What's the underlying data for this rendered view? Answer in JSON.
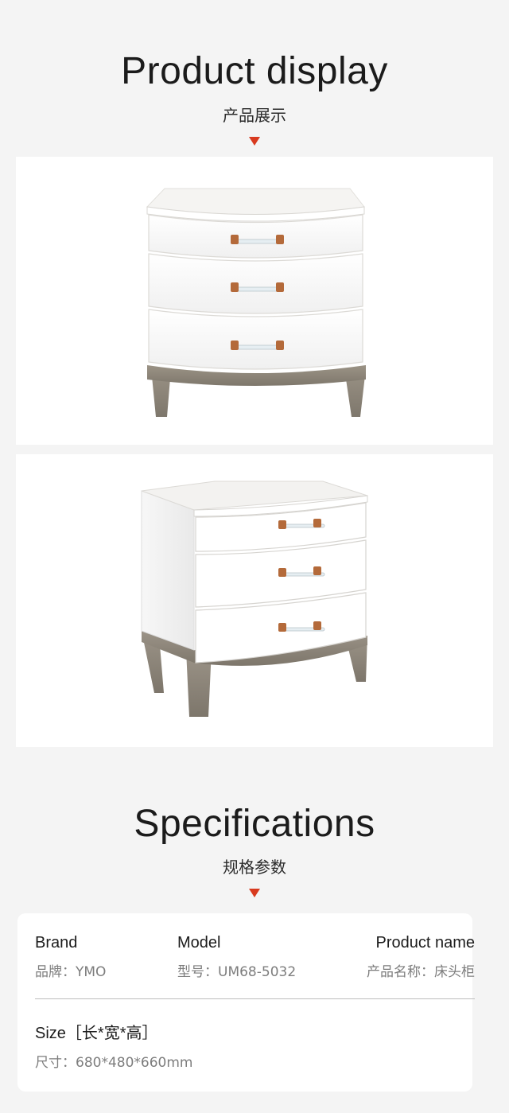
{
  "display": {
    "title": "Product display",
    "subtitle": "产品展示"
  },
  "specs": {
    "title": "Specifications",
    "subtitle": "规格参数",
    "brand": {
      "label": "Brand",
      "value": "品牌：YMO"
    },
    "model": {
      "label": "Model",
      "value": "型号：UM68-5032"
    },
    "product_name": {
      "label": "Product name",
      "value": "产品名称：床头柜"
    },
    "size": {
      "label": "Size［长*宽*高］",
      "value": "尺寸：680*480*660mm"
    }
  },
  "colors": {
    "accent": "#d83a1f",
    "background": "#f4f4f4",
    "cabinet_body": "#ffffff",
    "cabinet_base": "#8f877c",
    "handle_leather": "#b46a3a"
  }
}
